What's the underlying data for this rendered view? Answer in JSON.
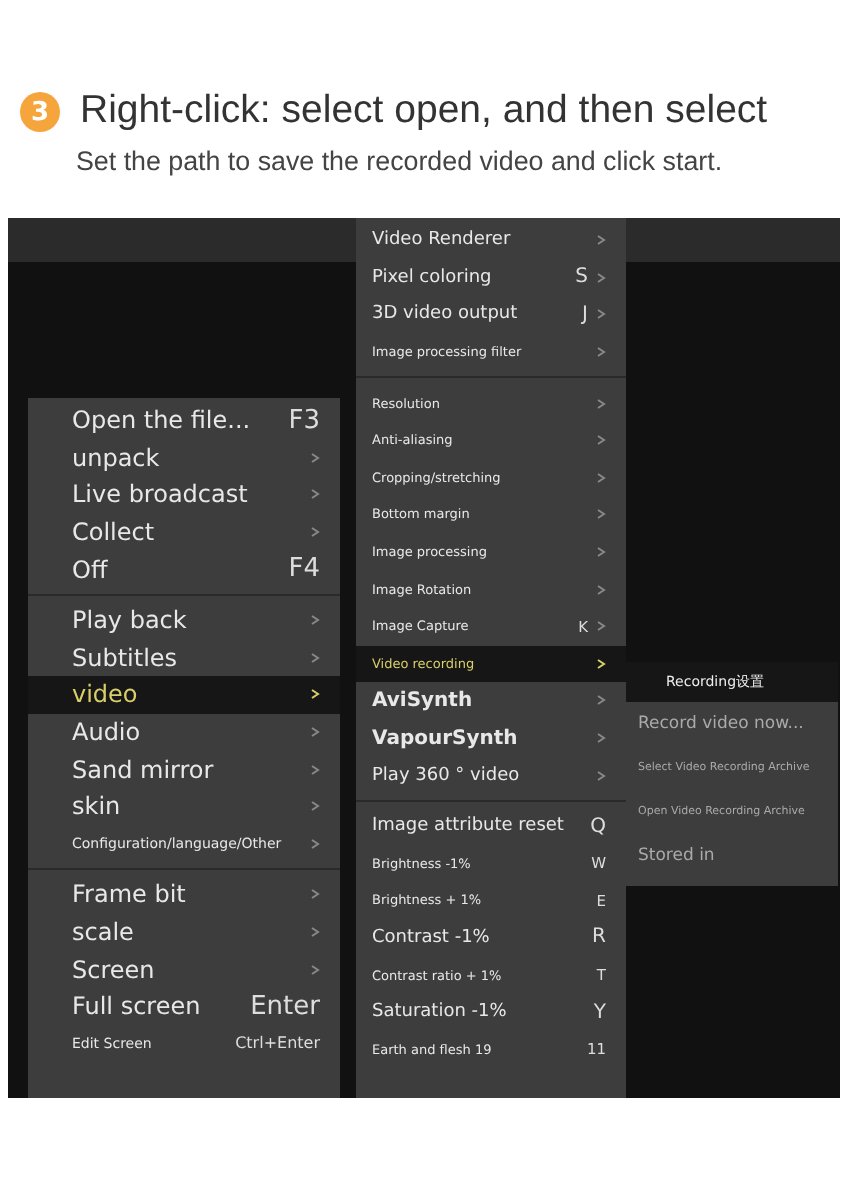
{
  "step": {
    "number": "3",
    "title": "Right-click: select open, and then select",
    "subtitle": "Set the path to save the recorded video and click start."
  },
  "main_menu": [
    {
      "kind": "item",
      "label": "Open the file...",
      "shortcut": "F3",
      "submenu": false,
      "selected": false
    },
    {
      "kind": "item",
      "label": "unpack",
      "submenu": true,
      "selected": false
    },
    {
      "kind": "item",
      "label": "Live broadcast",
      "submenu": true,
      "selected": false
    },
    {
      "kind": "item",
      "label": "Collect",
      "submenu": true,
      "selected": false
    },
    {
      "kind": "item",
      "label": "Off",
      "shortcut": "F4",
      "submenu": false,
      "selected": false
    },
    {
      "kind": "separator"
    },
    {
      "kind": "item",
      "label": "Play back",
      "submenu": true,
      "selected": false
    },
    {
      "kind": "item",
      "label": "Subtitles",
      "submenu": true,
      "selected": false
    },
    {
      "kind": "item",
      "label": "video",
      "submenu": true,
      "selected": true
    },
    {
      "kind": "item",
      "label": "Audio",
      "submenu": true,
      "selected": false
    },
    {
      "kind": "item",
      "label": "Sand mirror",
      "submenu": true,
      "selected": false
    },
    {
      "kind": "item",
      "label": "skin",
      "submenu": true,
      "selected": false
    },
    {
      "kind": "small",
      "label": "Configuration/language/Other",
      "submenu": true,
      "selected": false
    },
    {
      "kind": "separator"
    },
    {
      "kind": "item",
      "label": "Frame bit",
      "submenu": true,
      "selected": false
    },
    {
      "kind": "item",
      "label": "scale",
      "submenu": true,
      "selected": false
    },
    {
      "kind": "item",
      "label": "Screen",
      "submenu": true,
      "selected": false
    },
    {
      "kind": "item",
      "label": "Full screen",
      "shortcut": "Enter",
      "submenu": false,
      "selected": false
    },
    {
      "kind": "small",
      "label": "Edit Screen",
      "shortcut": "Ctrl+Enter",
      "submenu": false,
      "selected": false
    }
  ],
  "video_menu": [
    {
      "kind": "item",
      "label": "Video Renderer",
      "submenu": true,
      "selected": false
    },
    {
      "kind": "item",
      "label": "Pixel coloring",
      "shortcut": "S",
      "submenu": true,
      "selected": false
    },
    {
      "kind": "item",
      "label": "3D video output",
      "shortcut": "J",
      "submenu": true,
      "selected": false
    },
    {
      "kind": "small",
      "label": "Image processing filter",
      "submenu": true,
      "selected": false
    },
    {
      "kind": "separator"
    },
    {
      "kind": "small",
      "label": "Resolution",
      "submenu": true,
      "selected": false
    },
    {
      "kind": "small",
      "label": "Anti-aliasing",
      "submenu": true,
      "selected": false
    },
    {
      "kind": "small",
      "label": "Cropping/stretching",
      "submenu": true,
      "selected": false
    },
    {
      "kind": "small",
      "label": "Bottom margin",
      "submenu": true,
      "selected": false
    },
    {
      "kind": "small",
      "label": "Image processing",
      "submenu": true,
      "selected": false
    },
    {
      "kind": "small",
      "label": "Image Rotation",
      "submenu": true,
      "selected": false
    },
    {
      "kind": "small",
      "label": "Image Capture",
      "shortcut": "K",
      "submenu": true,
      "selected": false
    },
    {
      "kind": "small",
      "label": "Video recording",
      "submenu": true,
      "selected": true
    },
    {
      "kind": "large",
      "label": "AviSynth",
      "submenu": true,
      "selected": false
    },
    {
      "kind": "large",
      "label": "VapourSynth",
      "submenu": true,
      "selected": false
    },
    {
      "kind": "item",
      "label": "Play 360 ° video",
      "submenu": true,
      "selected": false
    },
    {
      "kind": "separator"
    },
    {
      "kind": "item",
      "label": "Image attribute reset",
      "shortcut": "Q",
      "submenu": false,
      "selected": false
    },
    {
      "kind": "small",
      "label": "Brightness -1%",
      "shortcut": "W",
      "submenu": false,
      "selected": false
    },
    {
      "kind": "small",
      "label": "Brightness + 1%",
      "shortcut": "E",
      "submenu": false,
      "selected": false
    },
    {
      "kind": "item",
      "label": "Contrast -1%",
      "shortcut": "R",
      "submenu": false,
      "selected": false
    },
    {
      "kind": "small",
      "label": "Contrast ratio + 1%",
      "shortcut": "T",
      "submenu": false,
      "selected": false
    },
    {
      "kind": "item",
      "label": "Saturation -1%",
      "shortcut": "Y",
      "submenu": false,
      "selected": false
    },
    {
      "kind": "small",
      "label": "Earth and flesh 19",
      "shortcut": "11",
      "submenu": false,
      "selected": false
    }
  ],
  "recording_menu": {
    "title": "Recording设置",
    "items": [
      {
        "kind": "item",
        "label": "Record video now..."
      },
      {
        "kind": "small",
        "label": "Select Video Recording Archive"
      },
      {
        "kind": "small",
        "label": "Open Video Recording Archive"
      },
      {
        "kind": "item",
        "label": "Stored in"
      }
    ]
  }
}
